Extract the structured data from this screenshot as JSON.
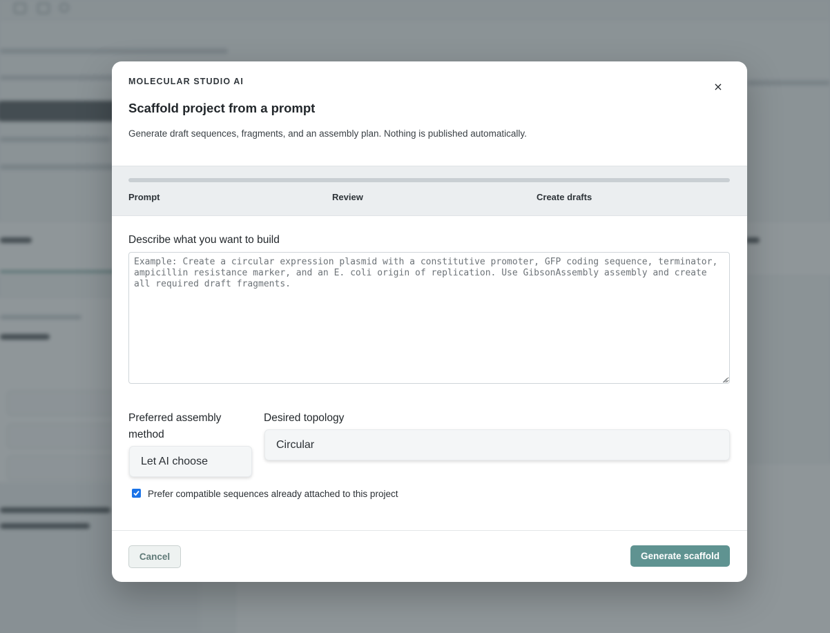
{
  "modal": {
    "kicker": "MOLECULAR STUDIO AI",
    "title": "Scaffold project from a prompt",
    "subtitle": "Generate draft sequences, fragments, and an assembly plan. Nothing is published automatically.",
    "close_label": "×",
    "steps": [
      {
        "label": "Prompt"
      },
      {
        "label": "Review"
      },
      {
        "label": "Create drafts"
      }
    ],
    "prompt": {
      "label": "Describe what you want to build",
      "value": "",
      "placeholder": "Example: Create a circular expression plasmid with a constitutive promoter, GFP coding sequence, terminator, ampicillin resistance marker, and an E. coli origin of replication. Use GibsonAssembly assembly and create all required draft fragments."
    },
    "assembly": {
      "label": "Preferred assembly method",
      "selected": "Let AI choose"
    },
    "topology": {
      "label": "Desired topology",
      "selected": "Circular"
    },
    "prefer_compatible": {
      "checked": true,
      "label": "Prefer compatible sequences already attached to this project"
    },
    "footer": {
      "cancel_label": "Cancel",
      "submit_label": "Generate scaffold"
    }
  },
  "colors": {
    "primary": "#5f9391",
    "overlay": "rgba(74,86,90,0.62)",
    "checkbox": "#1a73e8"
  }
}
